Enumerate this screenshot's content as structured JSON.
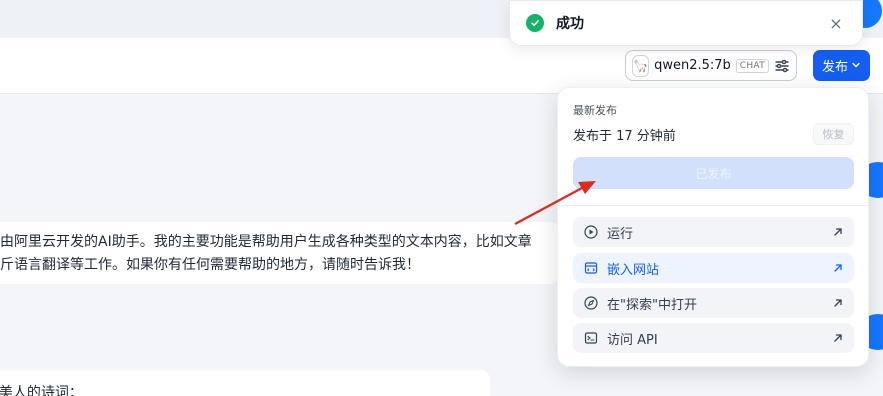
{
  "toast": {
    "message": "成功",
    "close_glyph": "×",
    "icon": "check-circle-icon"
  },
  "header": {
    "model": {
      "name": "qwen2.5:7b",
      "tag": "CHAT",
      "avatar_glyph": "🦙",
      "settings_icon": "sliders-icon"
    },
    "publish_button": {
      "label": "发布",
      "icon": "chevron-down-icon"
    }
  },
  "chat": {
    "message_lines": [
      "由阿里云开发的AI助手。我的主要功能是帮助用户生成各种类型的文本内容，比如文章",
      "斤语言翻译等工作。如果你有任何需要帮助的地方，请随时告诉我！"
    ],
    "bottom_text": "f美人的诗词："
  },
  "publish_panel": {
    "subtitle": "最新发布",
    "published_time": "发布于 17 分钟前",
    "restore_label": "恢复",
    "published_label": "已发布",
    "items": [
      {
        "label": "运行",
        "icon": "play-circle-icon"
      },
      {
        "label": "嵌入网站",
        "icon": "embed-icon"
      },
      {
        "label": "在\"探索\"中打开",
        "icon": "compass-icon"
      },
      {
        "label": "访问 API",
        "icon": "terminal-icon"
      }
    ],
    "external_icon": "arrow-up-right-icon"
  },
  "colors": {
    "primary": "#155eef",
    "success": "#17b26a",
    "annotation_arrow": "#d92d20"
  }
}
